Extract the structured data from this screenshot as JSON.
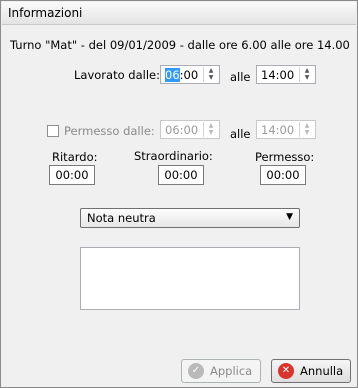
{
  "window": {
    "title": "Informazioni"
  },
  "shift": {
    "summary": "Turno \"Mat\" - del 09/01/2009 - dalle ore 6.00 alle ore 14.00"
  },
  "worked": {
    "label": "Lavorato dalle:",
    "from_selected": "06",
    "from_rest": ":00",
    "to_label": "alle",
    "to": "14:00"
  },
  "permit": {
    "label": "Permesso dalle:",
    "from": "06:00",
    "to_label": "alle",
    "to": "14:00",
    "checked": false
  },
  "totals": {
    "delay_label": "Ritardo:",
    "delay_value": "00:00",
    "overtime_label": "Straordinario:",
    "overtime_value": "00:00",
    "permit_label": "Permesso:",
    "permit_value": "00:00"
  },
  "note": {
    "selected": "Nota neutra",
    "text": ""
  },
  "buttons": {
    "apply": "Applica",
    "cancel": "Annulla"
  },
  "icons": {
    "apply": "check-circle-icon",
    "cancel": "x-circle-icon"
  },
  "colors": {
    "selection": "#3399ff",
    "cancel_icon": "#d9342b",
    "apply_icon_disabled": "#b9b9b9"
  }
}
